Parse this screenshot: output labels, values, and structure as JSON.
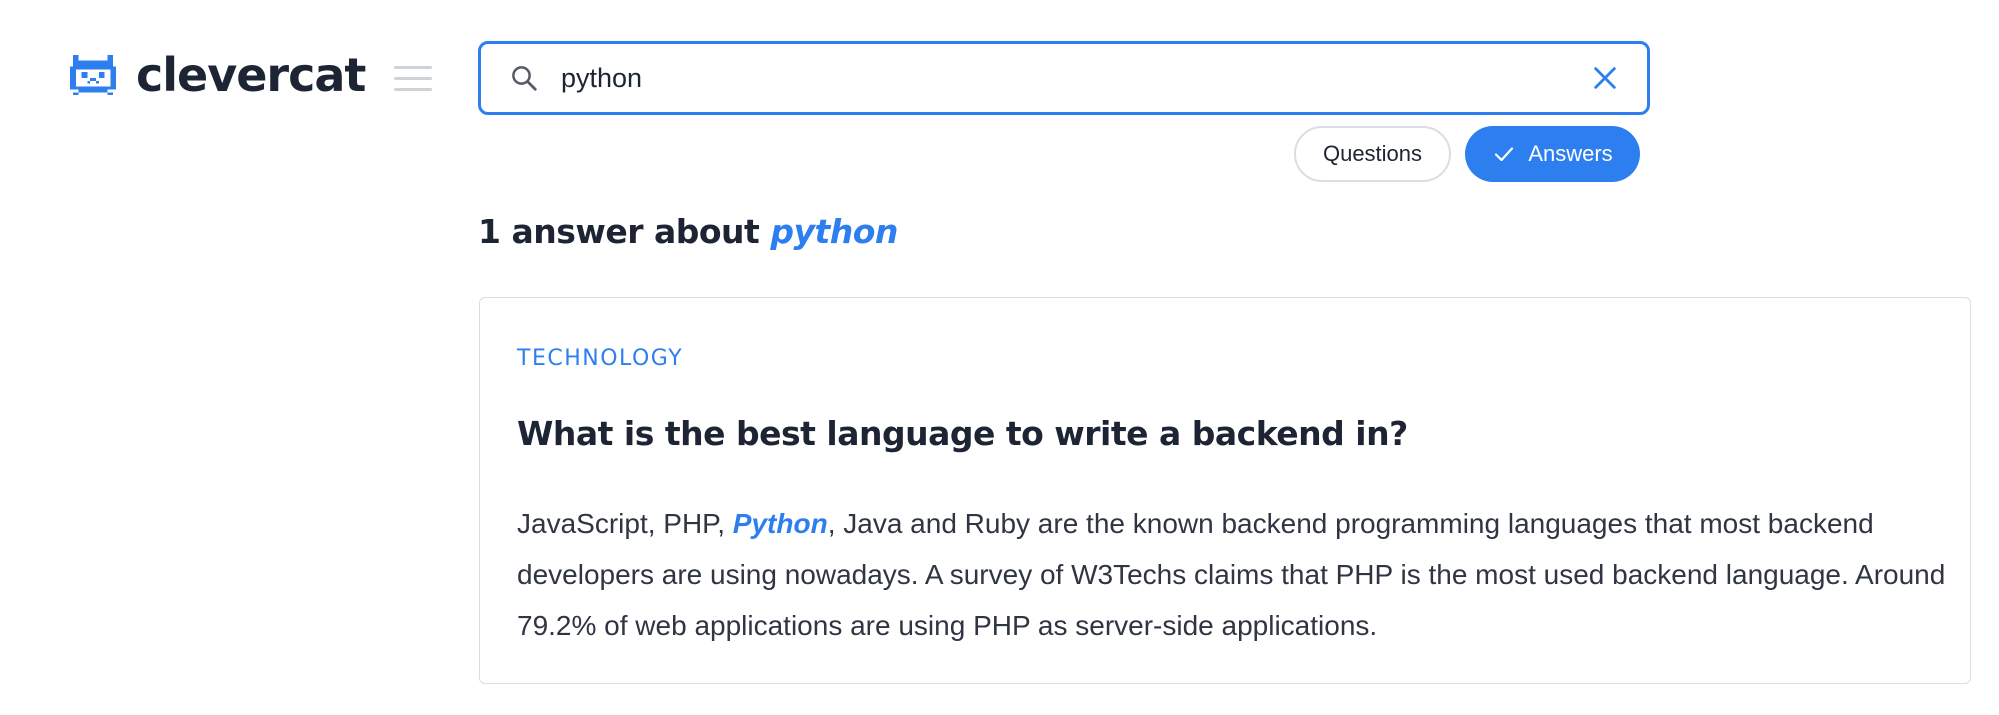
{
  "brand": {
    "name": "clevercat",
    "logo_icon": "cat-icon",
    "color": "#2d7ff0"
  },
  "header": {
    "menu_icon": "hamburger-menu-icon"
  },
  "search": {
    "value": "python",
    "placeholder": "",
    "icon": "search-icon",
    "clear_icon": "close-icon"
  },
  "filters": [
    {
      "label": "Questions",
      "active": false
    },
    {
      "label": "Answers",
      "active": true,
      "icon": "check-icon"
    }
  ],
  "results": {
    "count_text": "1 answer about",
    "term": "python"
  },
  "cards": [
    {
      "category": "TECHNOLOGY",
      "question": "What is the best language to write a backend in?",
      "answer_before": "JavaScript, PHP, ",
      "answer_highlight": "Python",
      "answer_after": ", Java and Ruby are the known backend programming languages that most backend developers are using nowadays. A survey of W3Techs claims that PHP is the most used backend language. Around 79.2% of web applications are using PHP as server-side applications."
    }
  ],
  "colors": {
    "accent": "#2d7ff0",
    "text": "#1d2433",
    "border": "#dadde2"
  }
}
